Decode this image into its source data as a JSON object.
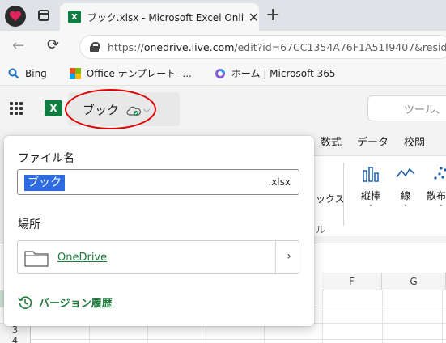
{
  "browser": {
    "tab_title": "ブック.xlsx - Microsoft Excel Online",
    "tab_close": "✕",
    "new_tab": "+",
    "url_prefix": "https://",
    "url_host": "onedrive.live.com",
    "url_rest": "/edit?id=67CC1354A76F1A51!9407&resid",
    "back": "←",
    "reload": "⟳"
  },
  "bookmarks": [
    {
      "label": "Bing"
    },
    {
      "label": "Office テンプレート -..."
    },
    {
      "label": "ホーム | Microsoft 365"
    }
  ],
  "excel": {
    "app_letter": "X",
    "file_title": "ブック",
    "chevron": "⌵",
    "tool_search_placeholder": "ツール、"
  },
  "ribbon": {
    "tabs": [
      "数式",
      "データ",
      "校閲"
    ],
    "left_text_1": "ックス",
    "left_text_2": "ル",
    "buttons": [
      {
        "label": "縦棒",
        "icon": "column-chart-icon"
      },
      {
        "label": "線",
        "icon": "line-chart-icon"
      },
      {
        "label": "散布図",
        "icon": "scatter-chart-icon"
      }
    ],
    "dropdown_glyph": "˅"
  },
  "sheet": {
    "columns": [
      "F",
      "G"
    ],
    "rows": [
      "3",
      "4"
    ]
  },
  "panel": {
    "filename_label": "ファイル名",
    "filename_value": "ブック",
    "filename_ext": ".xlsx",
    "location_label": "場所",
    "location_value": "OneDrive",
    "location_chevron": "›",
    "history_label": "バージョン履歴"
  },
  "colors": {
    "excel_green": "#107c41",
    "link_green": "#1e7a3c",
    "selection_blue": "#2e6be0",
    "annotation_red": "#e00000"
  }
}
